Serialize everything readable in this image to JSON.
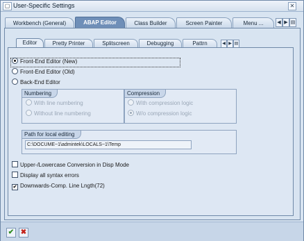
{
  "window": {
    "title": "User-Specific Settings",
    "app_icon": "window-icon",
    "close_symbol": "✕"
  },
  "top_tabs": [
    {
      "label": "Workbench (General)",
      "active": false
    },
    {
      "label": "ABAP Editor",
      "active": true
    },
    {
      "label": "Class Builder",
      "active": false
    },
    {
      "label": "Screen Painter",
      "active": false
    },
    {
      "label": "Menu ...",
      "active": false
    }
  ],
  "inner_tabs": [
    {
      "label": "Editor",
      "active": true
    },
    {
      "label": "Pretty Printer",
      "active": false
    },
    {
      "label": "Splitscreen",
      "active": false
    },
    {
      "label": "Debugging",
      "active": false
    },
    {
      "label": "Pattrn",
      "active": false
    }
  ],
  "nav": {
    "prev": "◀",
    "next": "▶",
    "menu": "▤"
  },
  "editor_options": [
    {
      "label": "Front-End Editor (New)",
      "selected": true
    },
    {
      "label": "Front-End Editor (Old)",
      "selected": false
    },
    {
      "label": "Back-End Editor",
      "selected": false
    }
  ],
  "numbering": {
    "title": "Numbering",
    "options": [
      {
        "label": "With line numbering",
        "selected": false
      },
      {
        "label": "Without line numbering",
        "selected": false
      }
    ]
  },
  "compression": {
    "title": "Compression",
    "options": [
      {
        "label": "With compression logic",
        "selected": false
      },
      {
        "label": "W/o compression logic",
        "selected": true
      }
    ]
  },
  "path": {
    "title": "Path for local editing",
    "value": "C:\\DOCUME~1\\admintek\\LOCALS~1\\Temp"
  },
  "checkboxes": [
    {
      "label": "Upper-/Lowercase Conversion in Disp Mode",
      "checked": false
    },
    {
      "label": "Display all syntax errors",
      "checked": false
    },
    {
      "label": "Downwards-Comp. Line Lngth(72)",
      "checked": true
    }
  ],
  "actions": {
    "confirm": "✔",
    "cancel": "✖"
  },
  "colors": {
    "confirm": "#2e8b1e",
    "cancel": "#c4231b",
    "active_tab": "#6f8fb8"
  }
}
